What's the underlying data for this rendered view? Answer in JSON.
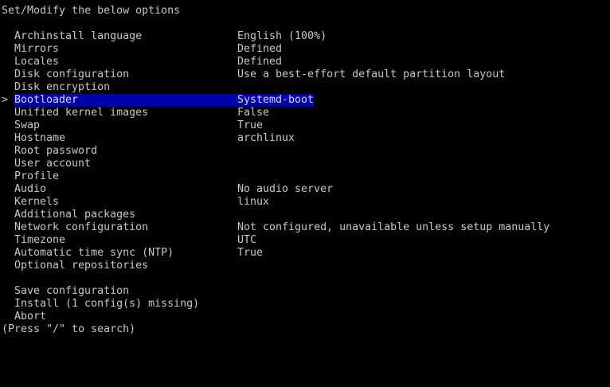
{
  "header": "Set/Modify the below options",
  "cursor_symbol": ">",
  "menu": [
    {
      "label": "Archinstall language",
      "value": "English (100%)"
    },
    {
      "label": "Mirrors",
      "value": "Defined"
    },
    {
      "label": "Locales",
      "value": "Defined"
    },
    {
      "label": "Disk configuration",
      "value": "Use a best-effort default partition layout"
    },
    {
      "label": "Disk encryption",
      "value": ""
    },
    {
      "label": "Bootloader",
      "value": "Systemd-boot",
      "selected": true
    },
    {
      "label": "Unified kernel images",
      "value": "False"
    },
    {
      "label": "Swap",
      "value": "True"
    },
    {
      "label": "Hostname",
      "value": "archlinux"
    },
    {
      "label": "Root password",
      "value": ""
    },
    {
      "label": "User account",
      "value": ""
    },
    {
      "label": "Profile",
      "value": ""
    },
    {
      "label": "Audio",
      "value": "No audio server"
    },
    {
      "label": "Kernels",
      "value": "linux"
    },
    {
      "label": "Additional packages",
      "value": ""
    },
    {
      "label": "Network configuration",
      "value": "Not configured, unavailable unless setup manually"
    },
    {
      "label": "Timezone",
      "value": "UTC"
    },
    {
      "label": "Automatic time sync (NTP)",
      "value": "True"
    },
    {
      "label": "Optional repositories",
      "value": ""
    }
  ],
  "actions": [
    {
      "label": "Save configuration"
    },
    {
      "label": "Install (1 config(s) missing)"
    },
    {
      "label": "Abort"
    }
  ],
  "footer": "(Press \"/\" to search)",
  "colors": {
    "background": "#000000",
    "text": "#c8c8c8",
    "selection_bg": "#0000aa"
  }
}
